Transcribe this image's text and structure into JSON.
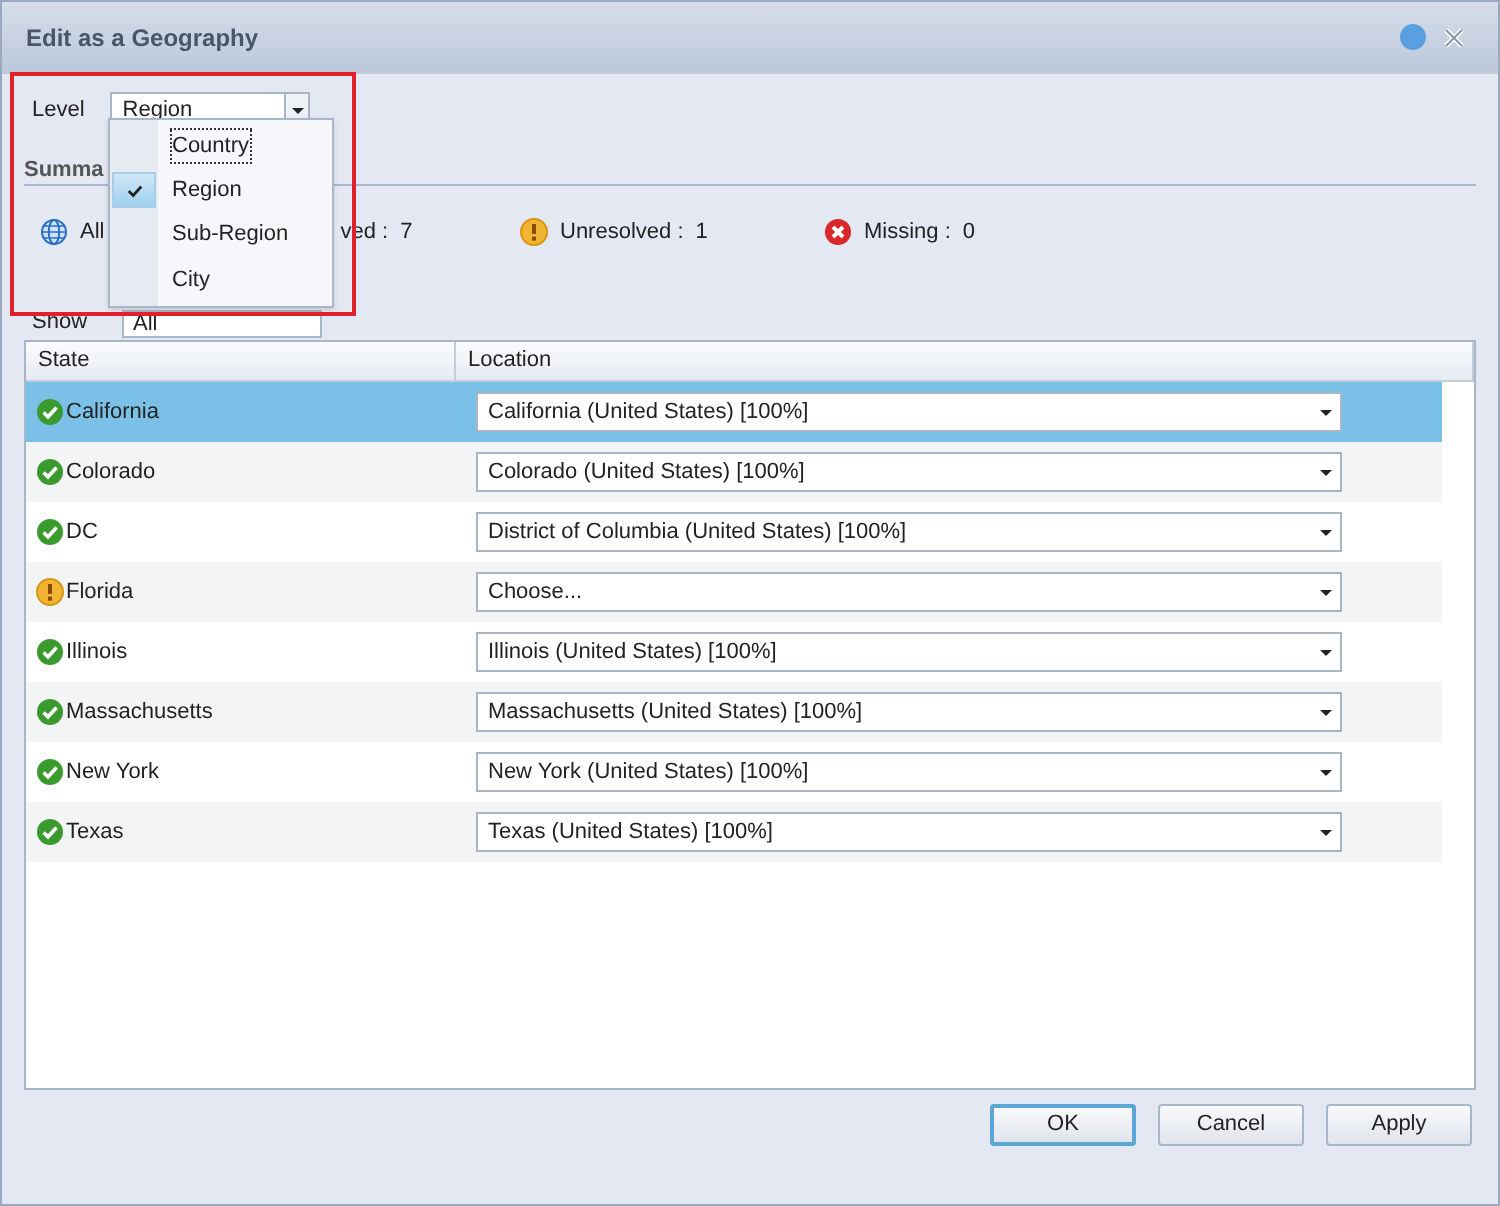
{
  "window": {
    "title": "Edit as a Geography"
  },
  "level": {
    "label": "Level",
    "value": "Region",
    "options": [
      {
        "label": "Country",
        "selected": false,
        "focused": true
      },
      {
        "label": "Region",
        "selected": true,
        "focused": false
      },
      {
        "label": "Sub-Region",
        "selected": false,
        "focused": false
      },
      {
        "label": "City",
        "selected": false,
        "focused": false
      }
    ]
  },
  "summary": {
    "title": "Summa",
    "items": [
      {
        "kind": "all",
        "label": "All",
        "tail": "ved :",
        "count": "7"
      },
      {
        "kind": "unresolved",
        "label": "Unresolved :",
        "count": "1"
      },
      {
        "kind": "missing",
        "label": "Missing :",
        "count": "0"
      }
    ]
  },
  "show": {
    "label": "Show",
    "value": "All"
  },
  "table": {
    "columns": [
      "State",
      "Location"
    ],
    "rows": [
      {
        "kind": "resolved",
        "state": "California",
        "location": "California (United States) [100%]",
        "selected": true
      },
      {
        "kind": "resolved",
        "state": "Colorado",
        "location": "Colorado (United States) [100%]",
        "selected": false
      },
      {
        "kind": "resolved",
        "state": "DC",
        "location": "District of Columbia (United States) [100%]",
        "selected": false
      },
      {
        "kind": "unresolved",
        "state": "Florida",
        "location": "Choose...",
        "selected": false
      },
      {
        "kind": "resolved",
        "state": "Illinois",
        "location": "Illinois (United States) [100%]",
        "selected": false
      },
      {
        "kind": "resolved",
        "state": "Massachusetts",
        "location": "Massachusetts (United States) [100%]",
        "selected": false
      },
      {
        "kind": "resolved",
        "state": "New York",
        "location": "New York (United States) [100%]",
        "selected": false
      },
      {
        "kind": "resolved",
        "state": "Texas",
        "location": "Texas (United States) [100%]",
        "selected": false
      }
    ]
  },
  "buttons": [
    {
      "label": "OK",
      "default": true
    },
    {
      "label": "Cancel",
      "default": false
    },
    {
      "label": "Apply",
      "default": false
    }
  ]
}
